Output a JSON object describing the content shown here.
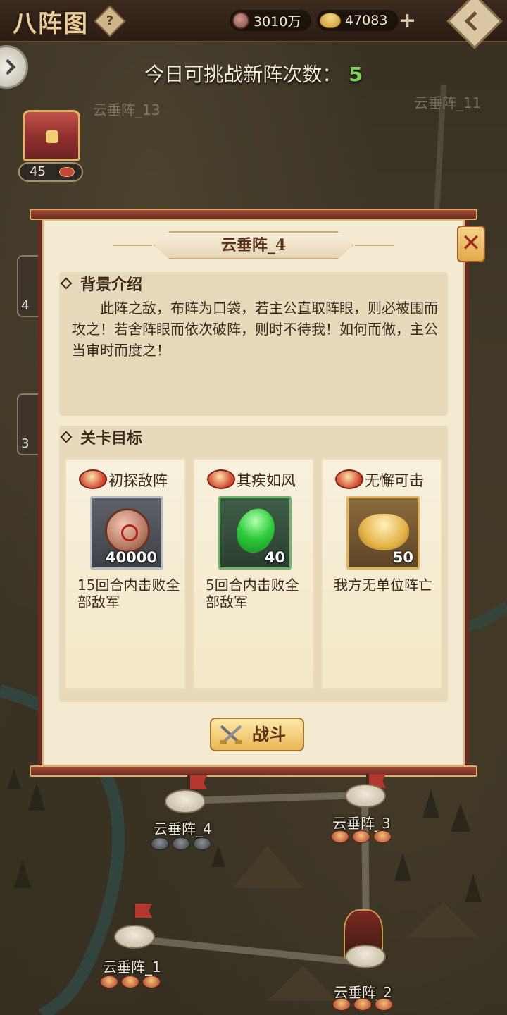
{
  "header": {
    "title": "八阵图",
    "help_symbol": "?",
    "copper": "3010万",
    "ingot": "47083",
    "add_symbol": "+"
  },
  "challenge": {
    "label": "今日可挑战新阵次数：",
    "count": "5"
  },
  "map": {
    "chest_count": "45",
    "side_counts": [
      "4",
      "3"
    ],
    "nodes": {
      "n13": "云垂阵_13",
      "n11": "云垂阵_11",
      "n4": "云垂阵_4",
      "n3": "云垂阵_3",
      "n1": "云垂阵_1",
      "n2": "云垂阵_2"
    }
  },
  "modal": {
    "stage_name": "云垂阵_4",
    "close_symbol": "✕",
    "background_title": "背景介绍",
    "background_text": "此阵之敌，布阵为口袋，若主公直取阵眼，则必被围而攻之！若舍阵眼而依次破阵，则时不待我！如何而做，主公当审时而度之！",
    "goals_title": "关卡目标",
    "goals": [
      {
        "title": "初探敌阵",
        "reward_icon": "copper-coin-icon",
        "amount": "40000",
        "desc": "15回合内击败全部敌军"
      },
      {
        "title": "其疾如风",
        "reward_icon": "jade-icon",
        "amount": "40",
        "desc": "5回合内击败全部敌军"
      },
      {
        "title": "无懈可击",
        "reward_icon": "gold-ingot-icon",
        "amount": "50",
        "desc": "我方无单位阵亡"
      }
    ],
    "fight_label": "战斗"
  },
  "colors": {
    "accent_green": "#7fd35b",
    "scroll_red": "#6a2a1f",
    "paper": "#f4ead2"
  }
}
